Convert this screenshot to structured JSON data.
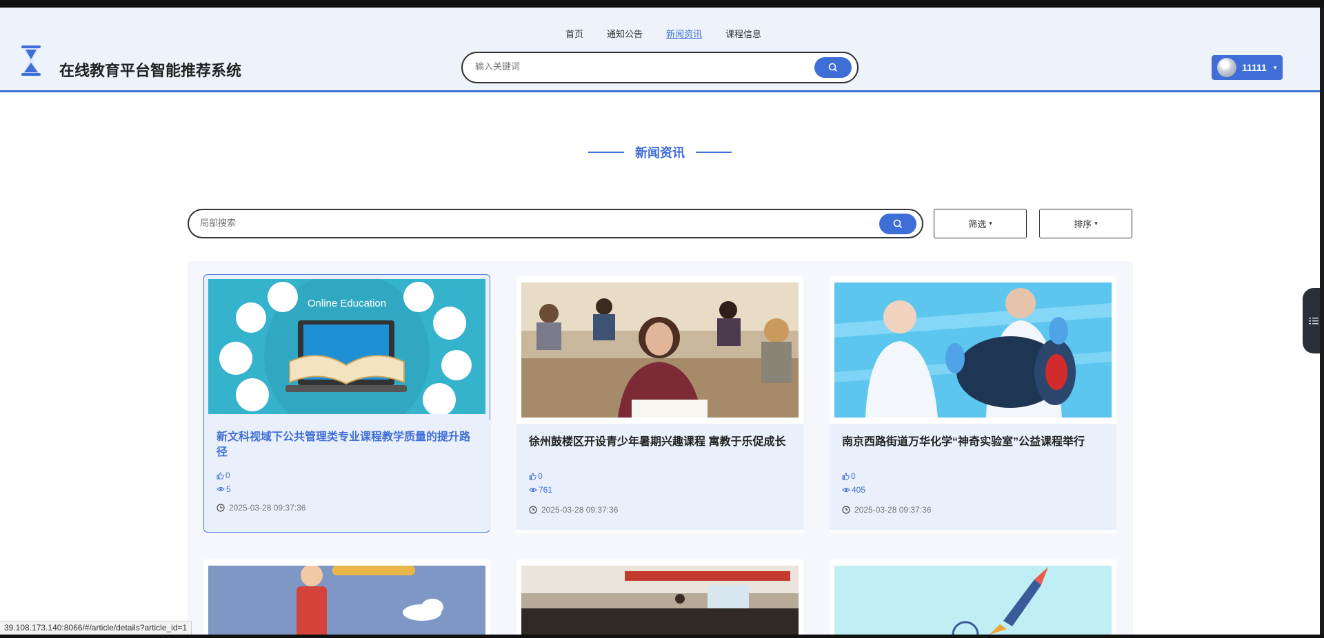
{
  "nav": {
    "items": [
      {
        "label": "首页"
      },
      {
        "label": "通知公告"
      },
      {
        "label": "新闻资讯",
        "active": true
      },
      {
        "label": "课程信息"
      }
    ]
  },
  "brand": {
    "title": "在线教育平台智能推荐系统"
  },
  "header_search": {
    "placeholder": "输入关键词"
  },
  "user": {
    "name": "11111"
  },
  "section": {
    "title": "新闻资讯"
  },
  "local_search": {
    "placeholder": "局部搜索"
  },
  "filter": {
    "label": "筛选"
  },
  "sort": {
    "label": "排序"
  },
  "cards": [
    {
      "title": "新文科视域下公共管理类专业课程教学质量的提升路径",
      "likes": "0",
      "views": "5",
      "date": "2025-03-28 09:37:36",
      "image": "online-education-illustration"
    },
    {
      "title": "徐州鼓楼区开设青少年暑期兴趣课程 寓教于乐促成长",
      "likes": "0",
      "views": "761",
      "date": "2025-03-28 09:37:36",
      "image": "classroom-exam-photo"
    },
    {
      "title": "南京西路街道万华化学“神奇实验室”公益课程举行",
      "likes": "0",
      "views": "405",
      "date": "2025-03-28 09:37:36",
      "image": "science-lab-photo"
    },
    {
      "image": "telescope-illustration"
    },
    {
      "image": "lecture-hall-photo"
    },
    {
      "image": "ideas-rocket-illustration"
    }
  ],
  "status_bar": {
    "url": "39.108.173.140:8066/#/article/details?article_id=1"
  },
  "colors": {
    "accent": "#3f6ed6",
    "header_bg": "#eef3fb",
    "card_bg": "#eaf0fb"
  }
}
